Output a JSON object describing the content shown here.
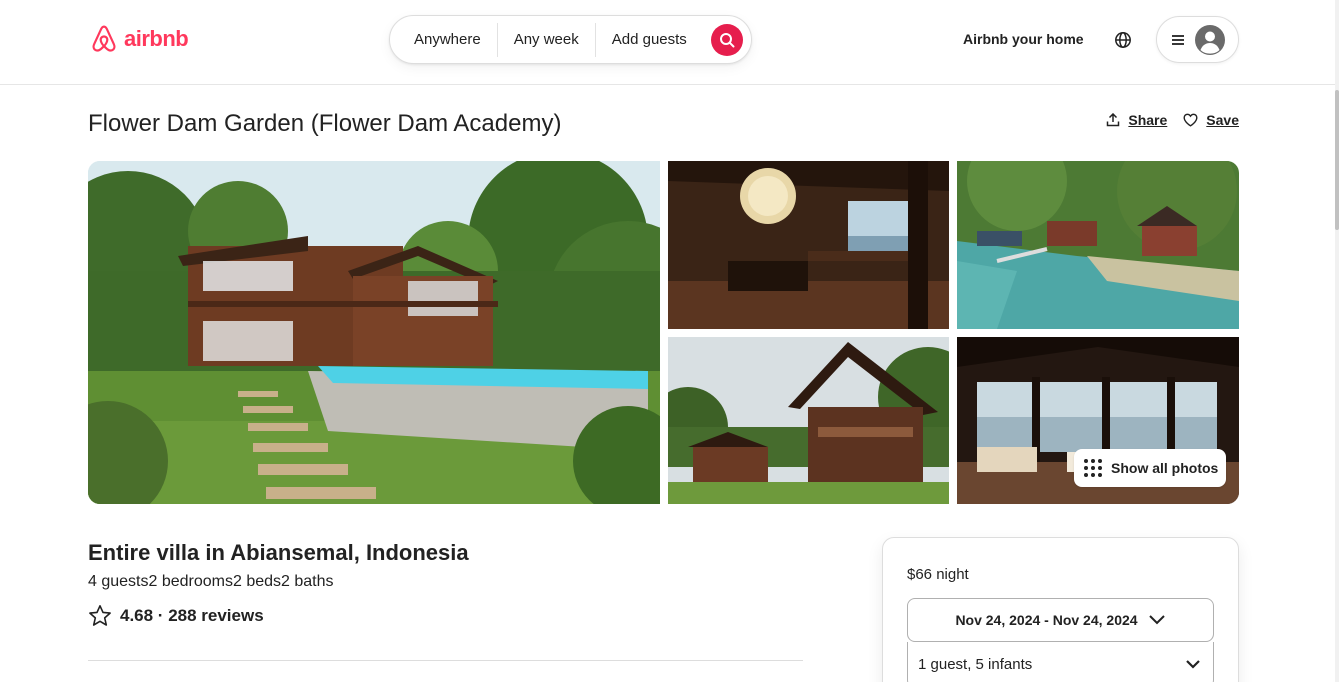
{
  "header": {
    "brand": "airbnb",
    "brand_color": "#ff385c",
    "search": {
      "where": "Anywhere",
      "when": "Any week",
      "who": "Add guests",
      "button_color": "#e61e4d",
      "icon": "search-icon"
    },
    "host_link": "Airbnb your home",
    "globe_icon": "globe-icon",
    "menu_icon": "hamburger-icon",
    "avatar_icon": "user-avatar-icon"
  },
  "listing": {
    "title": "Flower Dam Garden (Flower Dam Academy)",
    "share_label": "Share",
    "save_label": "Save",
    "show_all_photos": "Show all photos",
    "subtitle": "Entire villa in Abiansemal, Indonesia",
    "details": [
      "4 guests",
      "2 bedrooms",
      "2 beds",
      "2 baths"
    ],
    "rating_text": "4.68 · 288 reviews"
  },
  "booking": {
    "price": "$66 night",
    "dates": "Nov 24, 2024 - Nov 24, 2024",
    "guests": "1 guest, 5 infants"
  }
}
